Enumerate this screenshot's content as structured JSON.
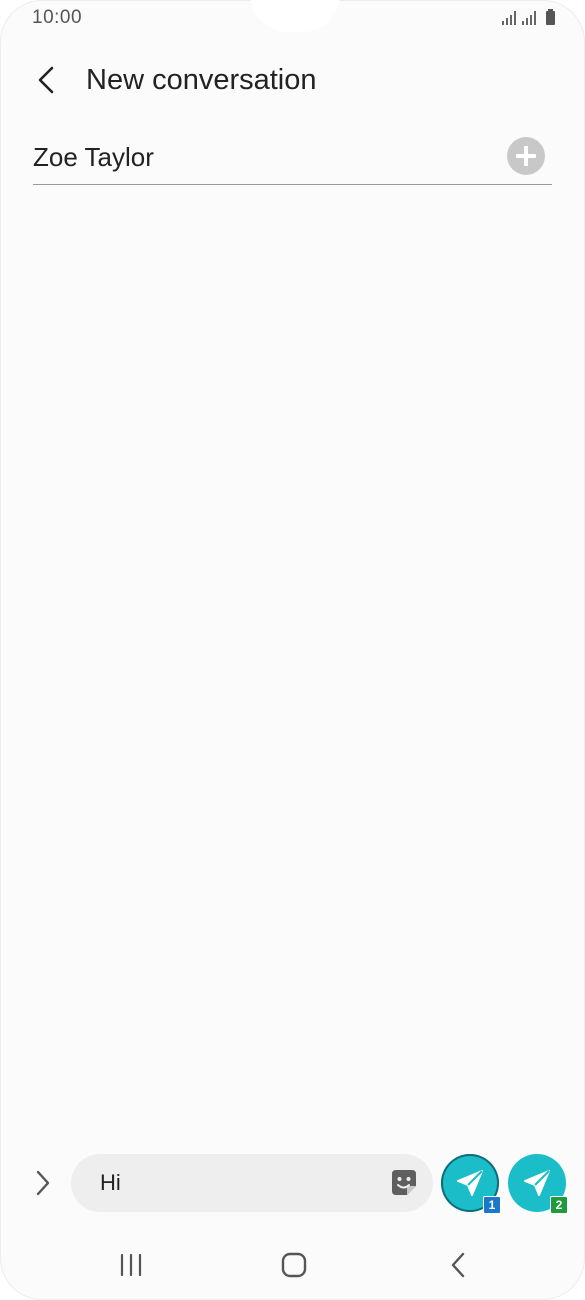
{
  "status_bar": {
    "time": "10:00",
    "icons": [
      "signal-sim1-icon",
      "signal-sim2-icon",
      "battery-icon"
    ]
  },
  "header": {
    "title": "New conversation",
    "back_icon": "chevron-left-icon"
  },
  "recipient": {
    "name": "Zoe Taylor",
    "add_icon": "plus-circle-icon"
  },
  "composer": {
    "expand_icon": "chevron-right-icon",
    "message_value": "Hi",
    "sticker_icon": "sticker-icon",
    "send_sim1": {
      "icon": "send-icon",
      "badge": "1"
    },
    "send_sim2": {
      "icon": "send-icon",
      "badge": "2"
    },
    "accent_color": "#1bbec8"
  },
  "nav_bar": {
    "recent_icon": "recent-apps-icon",
    "home_icon": "home-icon",
    "back_icon": "back-icon"
  }
}
